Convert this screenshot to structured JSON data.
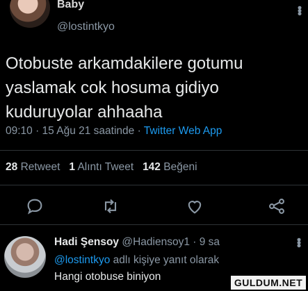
{
  "author": {
    "name": "Baby",
    "handle": "@lostintkyo"
  },
  "tweet": {
    "line1": "Otobuste arkamdakilere gotumu",
    "line2": "yaslamak cok hosuma gidiyo",
    "line3": "kuduruyolar ahhaaha",
    "time_date": "09:10 · 15 Ağu 21 saatinde · ",
    "source": "Twitter Web App"
  },
  "stats": {
    "retweets_count": "28",
    "retweets_label": "Retweet",
    "quotes_count": "1",
    "quotes_label": "Alıntı Tweet",
    "likes_count": "142",
    "likes_label": "Beğeni"
  },
  "actions": [
    "reply-icon",
    "retweet-icon",
    "like-icon",
    "share-icon"
  ],
  "reply": {
    "name": "Hadi Şensoy",
    "handle_time": "@Hadiensoy1 · 9 sa",
    "replying_handle": "@lostintkyo",
    "replying_suffix": " adlı kişiye yanıt olarak",
    "text": "Hangi otobuse biniyon"
  },
  "watermark": "GULDUM.NET",
  "colors": {
    "background": "#000000",
    "accent": "#1d9bf0",
    "muted": "#8b98a5"
  }
}
